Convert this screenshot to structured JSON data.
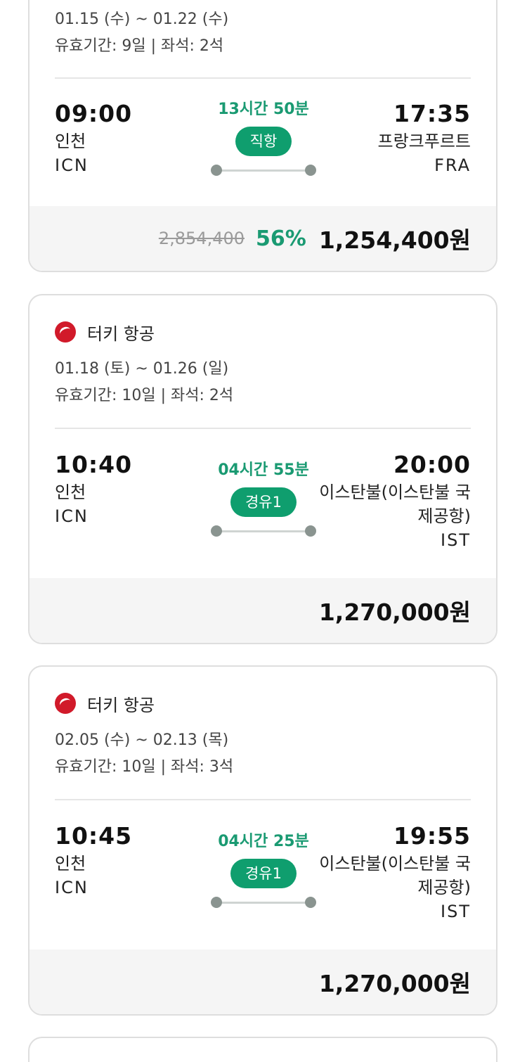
{
  "cards": [
    {
      "dates": "01.15 (수) ~ 01.22 (수)",
      "validity": "유효기간: 9일 | 좌석: 2석",
      "dep_time": "09:00",
      "dep_city": "인천",
      "dep_code": "ICN",
      "duration": "13시간 50분",
      "badge": "직항",
      "arr_time": "17:35",
      "arr_city": "프랑크푸르트",
      "arr_code": "FRA",
      "original_price": "2,854,400",
      "discount": "56%",
      "price": "1,254,400원"
    },
    {
      "airline": "터키 항공",
      "airline_logo_icon": "turkish-airlines-logo-icon",
      "dates": "01.18 (토) ~ 01.26 (일)",
      "validity": "유효기간: 10일 | 좌석: 2석",
      "dep_time": "10:40",
      "dep_city": "인천",
      "dep_code": "ICN",
      "duration": "04시간 55분",
      "badge": "경유1",
      "arr_time": "20:00",
      "arr_city_line1": "이스탄불(이스탄불 국",
      "arr_city_line2": "제공항)",
      "arr_code": "IST",
      "price": "1,270,000원"
    },
    {
      "airline": "터키 항공",
      "airline_logo_icon": "turkish-airlines-logo-icon",
      "dates": "02.05 (수) ~ 02.13 (목)",
      "validity": "유효기간: 10일 | 좌석: 3석",
      "dep_time": "10:45",
      "dep_city": "인천",
      "dep_code": "ICN",
      "duration": "04시간 25분",
      "badge": "경유1",
      "arr_time": "19:55",
      "arr_city_line1": "이스탄불(이스탄불 국",
      "arr_city_line2": "제공항)",
      "arr_code": "IST",
      "price": "1,270,000원"
    }
  ],
  "colors": {
    "accent_green": "#0f9e6e",
    "duration_green": "#1a9a72",
    "price_bar_bg": "#f5f5f5",
    "airline_red": "#d11a2a"
  }
}
